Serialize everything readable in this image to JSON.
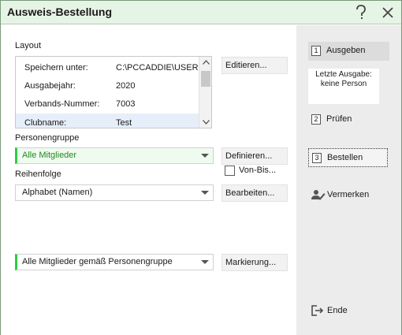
{
  "window": {
    "title": "Ausweis-Bestellung",
    "help_icon": "help-icon",
    "close_icon": "close-icon"
  },
  "layout": {
    "label": "Layout",
    "rows": [
      {
        "key": "Speichern unter:",
        "value": "C:\\PCCADDIE\\USER_"
      },
      {
        "key": "Ausgabejahr:",
        "value": "2020"
      },
      {
        "key": "Verbands-Nummer:",
        "value": "7003"
      },
      {
        "key": "Clubname:",
        "value": "Test"
      }
    ],
    "edit_button": "Editieren..."
  },
  "personengruppe": {
    "label": "Personengruppe",
    "selected": "Alle Mitglieder",
    "define_button": "Definieren...",
    "von_bis_label": "Von-Bis..."
  },
  "reihenfolge": {
    "label": "Reihenfolge",
    "selected": "Alphabet (Namen)",
    "edit_button": "Bearbeiten..."
  },
  "markierung": {
    "selected": "Alle Mitglieder gemäß Personengruppe",
    "button": "Markierung..."
  },
  "sidebar": {
    "ausgeben": {
      "num": "1",
      "label": "Ausgeben"
    },
    "info_line1": "Letzte Ausgabe:",
    "info_line2": "keine Person",
    "pruefen": {
      "num": "2",
      "label": "Prüfen"
    },
    "bestellen": {
      "num": "3",
      "label": "Bestellen"
    },
    "vermerken": {
      "label": "Vermerken",
      "icon": "user-edit-icon"
    },
    "ende": {
      "label": "Ende",
      "icon": "exit-icon"
    }
  },
  "colors": {
    "accent_green": "#2ecc40",
    "title_bg": "#e6f4e6"
  }
}
